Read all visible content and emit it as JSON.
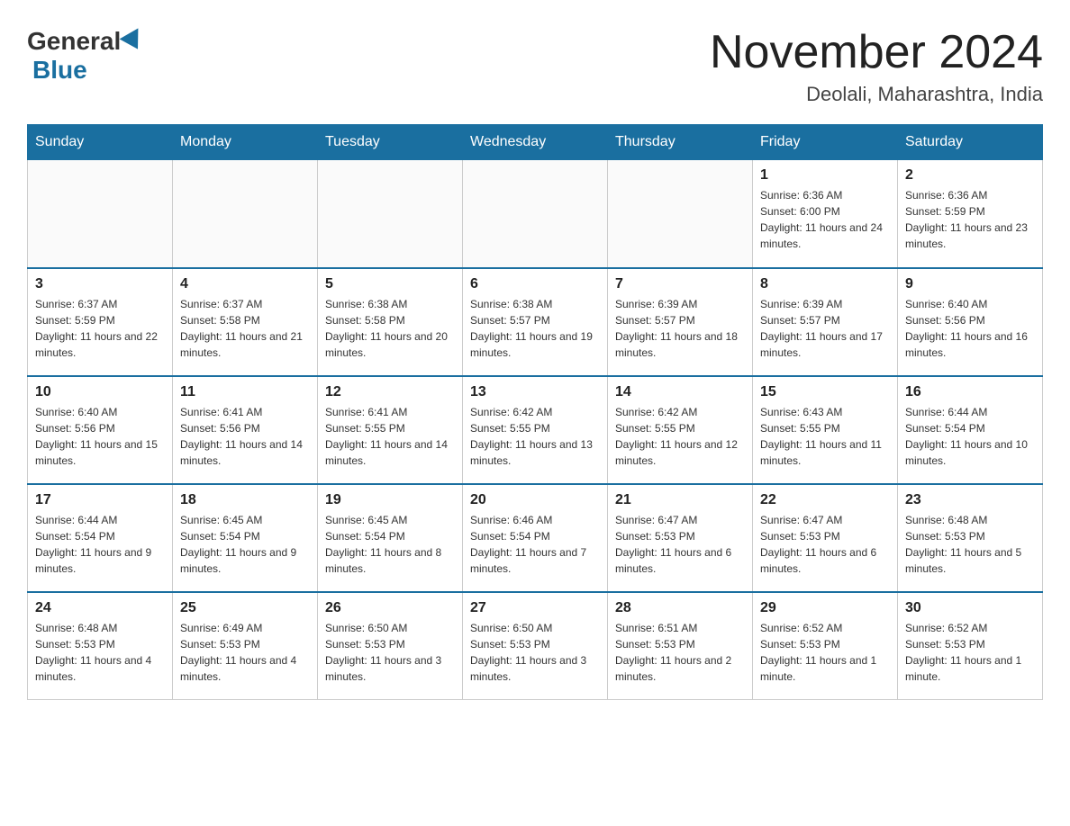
{
  "header": {
    "logo_general": "General",
    "logo_blue": "Blue",
    "month_title": "November 2024",
    "location": "Deolali, Maharashtra, India"
  },
  "weekdays": [
    "Sunday",
    "Monday",
    "Tuesday",
    "Wednesday",
    "Thursday",
    "Friday",
    "Saturday"
  ],
  "weeks": [
    [
      {
        "day": "",
        "sunrise": "",
        "sunset": "",
        "daylight": ""
      },
      {
        "day": "",
        "sunrise": "",
        "sunset": "",
        "daylight": ""
      },
      {
        "day": "",
        "sunrise": "",
        "sunset": "",
        "daylight": ""
      },
      {
        "day": "",
        "sunrise": "",
        "sunset": "",
        "daylight": ""
      },
      {
        "day": "",
        "sunrise": "",
        "sunset": "",
        "daylight": ""
      },
      {
        "day": "1",
        "sunrise": "Sunrise: 6:36 AM",
        "sunset": "Sunset: 6:00 PM",
        "daylight": "Daylight: 11 hours and 24 minutes."
      },
      {
        "day": "2",
        "sunrise": "Sunrise: 6:36 AM",
        "sunset": "Sunset: 5:59 PM",
        "daylight": "Daylight: 11 hours and 23 minutes."
      }
    ],
    [
      {
        "day": "3",
        "sunrise": "Sunrise: 6:37 AM",
        "sunset": "Sunset: 5:59 PM",
        "daylight": "Daylight: 11 hours and 22 minutes."
      },
      {
        "day": "4",
        "sunrise": "Sunrise: 6:37 AM",
        "sunset": "Sunset: 5:58 PM",
        "daylight": "Daylight: 11 hours and 21 minutes."
      },
      {
        "day": "5",
        "sunrise": "Sunrise: 6:38 AM",
        "sunset": "Sunset: 5:58 PM",
        "daylight": "Daylight: 11 hours and 20 minutes."
      },
      {
        "day": "6",
        "sunrise": "Sunrise: 6:38 AM",
        "sunset": "Sunset: 5:57 PM",
        "daylight": "Daylight: 11 hours and 19 minutes."
      },
      {
        "day": "7",
        "sunrise": "Sunrise: 6:39 AM",
        "sunset": "Sunset: 5:57 PM",
        "daylight": "Daylight: 11 hours and 18 minutes."
      },
      {
        "day": "8",
        "sunrise": "Sunrise: 6:39 AM",
        "sunset": "Sunset: 5:57 PM",
        "daylight": "Daylight: 11 hours and 17 minutes."
      },
      {
        "day": "9",
        "sunrise": "Sunrise: 6:40 AM",
        "sunset": "Sunset: 5:56 PM",
        "daylight": "Daylight: 11 hours and 16 minutes."
      }
    ],
    [
      {
        "day": "10",
        "sunrise": "Sunrise: 6:40 AM",
        "sunset": "Sunset: 5:56 PM",
        "daylight": "Daylight: 11 hours and 15 minutes."
      },
      {
        "day": "11",
        "sunrise": "Sunrise: 6:41 AM",
        "sunset": "Sunset: 5:56 PM",
        "daylight": "Daylight: 11 hours and 14 minutes."
      },
      {
        "day": "12",
        "sunrise": "Sunrise: 6:41 AM",
        "sunset": "Sunset: 5:55 PM",
        "daylight": "Daylight: 11 hours and 14 minutes."
      },
      {
        "day": "13",
        "sunrise": "Sunrise: 6:42 AM",
        "sunset": "Sunset: 5:55 PM",
        "daylight": "Daylight: 11 hours and 13 minutes."
      },
      {
        "day": "14",
        "sunrise": "Sunrise: 6:42 AM",
        "sunset": "Sunset: 5:55 PM",
        "daylight": "Daylight: 11 hours and 12 minutes."
      },
      {
        "day": "15",
        "sunrise": "Sunrise: 6:43 AM",
        "sunset": "Sunset: 5:55 PM",
        "daylight": "Daylight: 11 hours and 11 minutes."
      },
      {
        "day": "16",
        "sunrise": "Sunrise: 6:44 AM",
        "sunset": "Sunset: 5:54 PM",
        "daylight": "Daylight: 11 hours and 10 minutes."
      }
    ],
    [
      {
        "day": "17",
        "sunrise": "Sunrise: 6:44 AM",
        "sunset": "Sunset: 5:54 PM",
        "daylight": "Daylight: 11 hours and 9 minutes."
      },
      {
        "day": "18",
        "sunrise": "Sunrise: 6:45 AM",
        "sunset": "Sunset: 5:54 PM",
        "daylight": "Daylight: 11 hours and 9 minutes."
      },
      {
        "day": "19",
        "sunrise": "Sunrise: 6:45 AM",
        "sunset": "Sunset: 5:54 PM",
        "daylight": "Daylight: 11 hours and 8 minutes."
      },
      {
        "day": "20",
        "sunrise": "Sunrise: 6:46 AM",
        "sunset": "Sunset: 5:54 PM",
        "daylight": "Daylight: 11 hours and 7 minutes."
      },
      {
        "day": "21",
        "sunrise": "Sunrise: 6:47 AM",
        "sunset": "Sunset: 5:53 PM",
        "daylight": "Daylight: 11 hours and 6 minutes."
      },
      {
        "day": "22",
        "sunrise": "Sunrise: 6:47 AM",
        "sunset": "Sunset: 5:53 PM",
        "daylight": "Daylight: 11 hours and 6 minutes."
      },
      {
        "day": "23",
        "sunrise": "Sunrise: 6:48 AM",
        "sunset": "Sunset: 5:53 PM",
        "daylight": "Daylight: 11 hours and 5 minutes."
      }
    ],
    [
      {
        "day": "24",
        "sunrise": "Sunrise: 6:48 AM",
        "sunset": "Sunset: 5:53 PM",
        "daylight": "Daylight: 11 hours and 4 minutes."
      },
      {
        "day": "25",
        "sunrise": "Sunrise: 6:49 AM",
        "sunset": "Sunset: 5:53 PM",
        "daylight": "Daylight: 11 hours and 4 minutes."
      },
      {
        "day": "26",
        "sunrise": "Sunrise: 6:50 AM",
        "sunset": "Sunset: 5:53 PM",
        "daylight": "Daylight: 11 hours and 3 minutes."
      },
      {
        "day": "27",
        "sunrise": "Sunrise: 6:50 AM",
        "sunset": "Sunset: 5:53 PM",
        "daylight": "Daylight: 11 hours and 3 minutes."
      },
      {
        "day": "28",
        "sunrise": "Sunrise: 6:51 AM",
        "sunset": "Sunset: 5:53 PM",
        "daylight": "Daylight: 11 hours and 2 minutes."
      },
      {
        "day": "29",
        "sunrise": "Sunrise: 6:52 AM",
        "sunset": "Sunset: 5:53 PM",
        "daylight": "Daylight: 11 hours and 1 minute."
      },
      {
        "day": "30",
        "sunrise": "Sunrise: 6:52 AM",
        "sunset": "Sunset: 5:53 PM",
        "daylight": "Daylight: 11 hours and 1 minute."
      }
    ]
  ]
}
